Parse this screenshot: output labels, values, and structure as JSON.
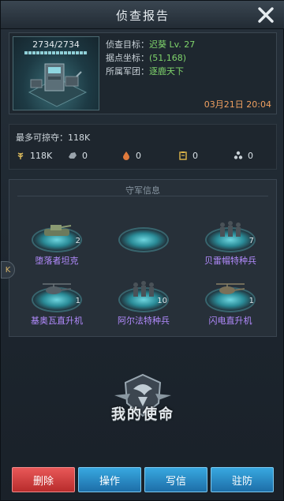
{
  "header": {
    "title": "侦查报告",
    "close_icon": "close-icon"
  },
  "report": {
    "base_hp": "2734/2734",
    "hp_fraction": 1.0,
    "target_label": "侦查目标：",
    "target_value": "迟葵 Lv. 27",
    "coords_label": "据点坐标：",
    "coords_value": "(51,168)",
    "legion_label": "所属军团：",
    "legion_value": "逐鹿天下",
    "datetime": "03月21日 20:04"
  },
  "loot": {
    "title": "最多可掠夺：118K",
    "resources": [
      {
        "icon": "wheat-icon",
        "value": "118K"
      },
      {
        "icon": "ore-icon",
        "value": "0"
      },
      {
        "icon": "oil-icon",
        "value": "0"
      },
      {
        "icon": "supply-icon",
        "value": "0"
      },
      {
        "icon": "crystal-icon",
        "value": "0"
      }
    ]
  },
  "defense": {
    "title": "守军信息",
    "units": [
      {
        "name": "堕落者坦克",
        "count": "2"
      },
      {
        "name": "",
        "count": ""
      },
      {
        "name": "贝雷帽特种兵",
        "count": "7"
      },
      {
        "name": "基奥瓦直升机",
        "count": "1"
      },
      {
        "name": "阿尔法特种兵",
        "count": "10"
      },
      {
        "name": "闪电直升机",
        "count": "1"
      }
    ]
  },
  "side_tab": "K",
  "emblem": {
    "text": "我的使命"
  },
  "buttons": {
    "delete": "删除",
    "operate": "操作",
    "mail": "写信",
    "garrison": "驻防"
  },
  "colors": {
    "accent_green": "#7fd46b",
    "date_orange": "#f0a060",
    "unit_name_purple": "#b38bff",
    "btn_red": "#d84444",
    "btn_blue": "#2a8cc8"
  }
}
